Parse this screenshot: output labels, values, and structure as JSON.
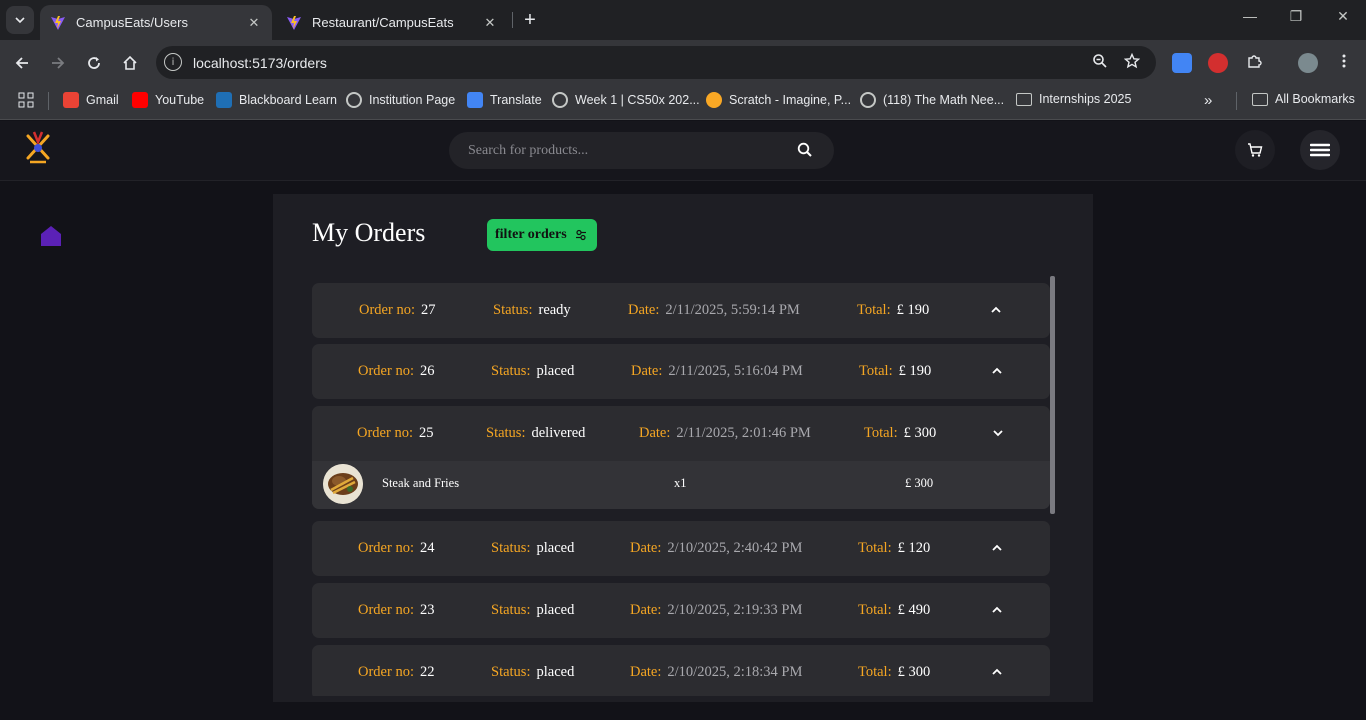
{
  "browser": {
    "tabs": [
      {
        "title": "CampusEats/Users",
        "active": true
      },
      {
        "title": "Restaurant/CampusEats",
        "active": false
      }
    ],
    "url": "localhost:5173/orders",
    "bookmarks": [
      {
        "label": "Gmail",
        "icon": "gmail-icon",
        "color": "#ea4335"
      },
      {
        "label": "YouTube",
        "icon": "youtube-icon",
        "color": "#ff0000"
      },
      {
        "label": "Blackboard Learn",
        "icon": "blackboard-icon",
        "color": "#1f6fb5"
      },
      {
        "label": "Institution Page",
        "icon": "globe-icon",
        "color": "#c4c7c5"
      },
      {
        "label": "Translate",
        "icon": "translate-icon",
        "color": "#4285f4"
      },
      {
        "label": "Week 1 | CS50x 202...",
        "icon": "globe-icon",
        "color": "#c4c7c5"
      },
      {
        "label": "Scratch - Imagine, P...",
        "icon": "scratch-icon",
        "color": "#f9a825"
      },
      {
        "label": "(118) The Math Nee...",
        "icon": "globe-icon",
        "color": "#c4c7c5"
      },
      {
        "label": "Internships 2025",
        "icon": "folder-icon",
        "color": "#c4c7c5"
      }
    ],
    "all_bookmarks_label": "All Bookmarks"
  },
  "header": {
    "search_placeholder": "Search for products..."
  },
  "main": {
    "title": "My Orders",
    "filter_label": "filter orders",
    "labels": {
      "order_no": "Order no:",
      "status": "Status:",
      "date": "Date:",
      "total": "Total:"
    },
    "orders": [
      {
        "no": "27",
        "status": "ready",
        "date": "2/11/2025, 5:59:14 PM",
        "total": "£ 190",
        "expanded": false
      },
      {
        "no": "26",
        "status": "placed",
        "date": "2/11/2025, 5:16:04 PM",
        "total": "£ 190",
        "expanded": false
      },
      {
        "no": "25",
        "status": "delivered",
        "date": "2/11/2025, 2:01:46 PM",
        "total": "£ 300",
        "expanded": true,
        "items": [
          {
            "name": "Steak and Fries",
            "qty": "x1",
            "price": "£ 300"
          }
        ]
      },
      {
        "no": "24",
        "status": "placed",
        "date": "2/10/2025, 2:40:42 PM",
        "total": "£ 120",
        "expanded": false
      },
      {
        "no": "23",
        "status": "placed",
        "date": "2/10/2025, 2:19:33 PM",
        "total": "£ 490",
        "expanded": false
      },
      {
        "no": "22",
        "status": "placed",
        "date": "2/10/2025, 2:18:34 PM",
        "total": "£ 300",
        "expanded": false
      }
    ]
  },
  "colors": {
    "accent_label": "#f5a623",
    "filter_button": "#22c55e",
    "home_icon": "#5b21b6"
  }
}
